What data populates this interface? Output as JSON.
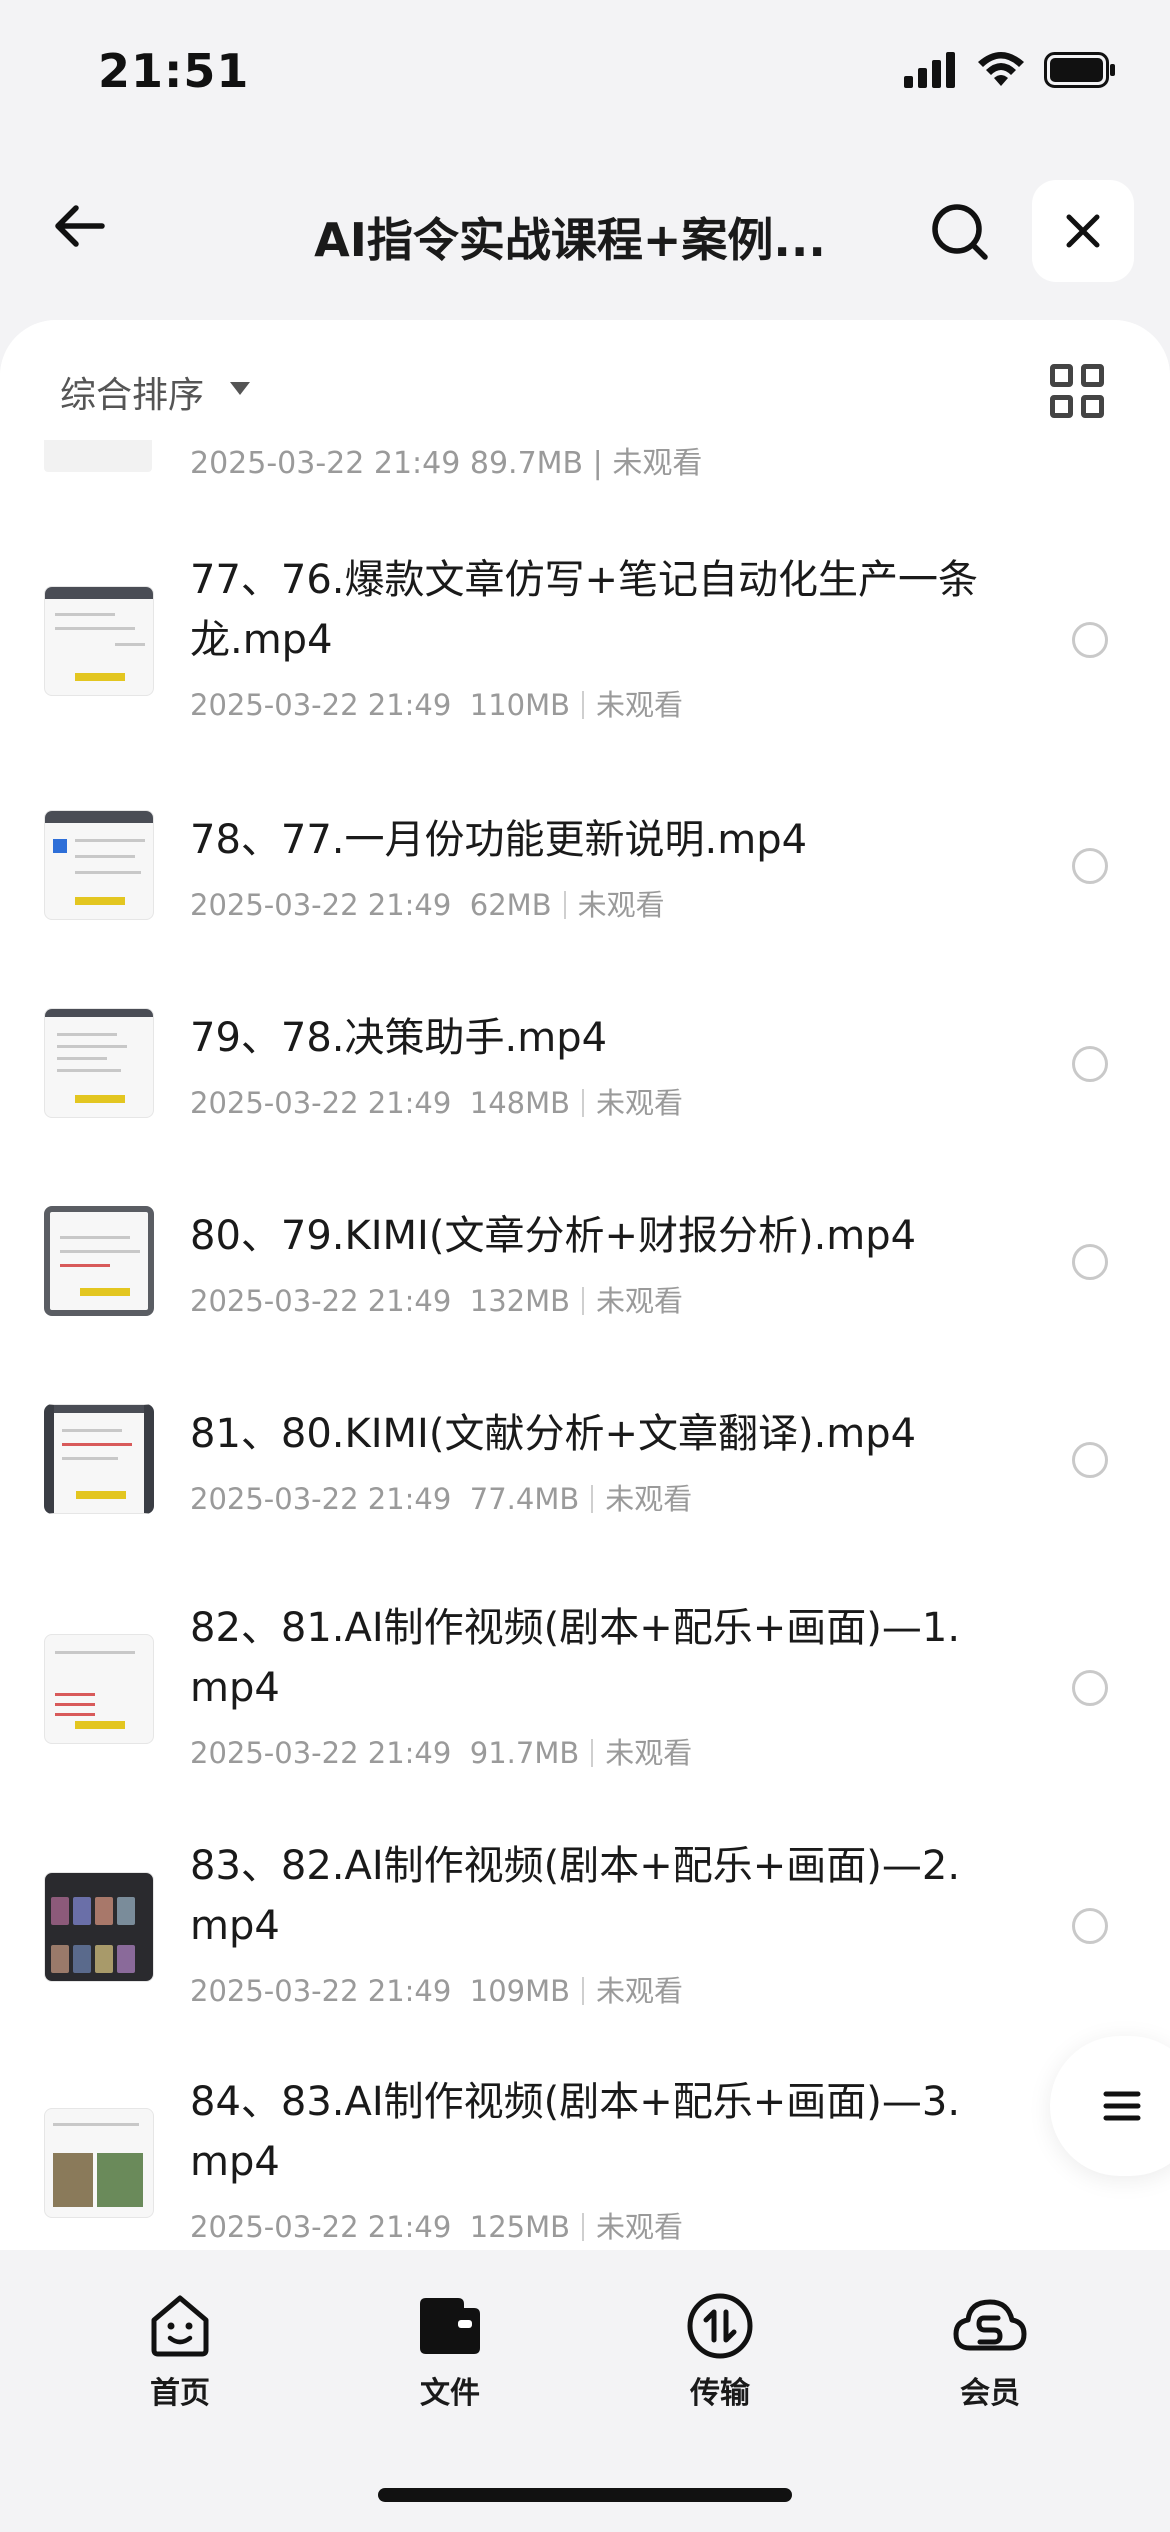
{
  "status_bar": {
    "time": "21:51"
  },
  "header": {
    "title": "AI指令实战课程+案例..."
  },
  "sort": {
    "label": "综合排序"
  },
  "partial_row": {
    "meta": "2025-03-22 21:49  89.7MB | 未观看"
  },
  "files": [
    {
      "name": "77、76.爆款文章仿写+笔记自动化生产一条龙.mp4",
      "date": "2025-03-22 21:49",
      "size": "110MB",
      "status": "未观看"
    },
    {
      "name": "78、77.一月份功能更新说明.mp4",
      "date": "2025-03-22 21:49",
      "size": "62MB",
      "status": "未观看"
    },
    {
      "name": "79、78.决策助手.mp4",
      "date": "2025-03-22 21:49",
      "size": "148MB",
      "status": "未观看"
    },
    {
      "name": "80、79.KIMI(文章分析+财报分析).mp4",
      "date": "2025-03-22 21:49",
      "size": "132MB",
      "status": "未观看"
    },
    {
      "name": "81、80.KIMI(文献分析+文章翻译).mp4",
      "date": "2025-03-22 21:49",
      "size": "77.4MB",
      "status": "未观看"
    },
    {
      "name": "82、81.AI制作视频(剧本+配乐+画面)—1.mp4",
      "date": "2025-03-22 21:49",
      "size": "91.7MB",
      "status": "未观看"
    },
    {
      "name": "83、82.AI制作视频(剧本+配乐+画面)—2.mp4",
      "date": "2025-03-22 21:49",
      "size": "109MB",
      "status": "未观看"
    },
    {
      "name": "84、83.AI制作视频(剧本+配乐+画面)—3.mp4",
      "date": "2025-03-22 21:49",
      "size": "125MB",
      "status": "未观看"
    }
  ],
  "nav": {
    "home": "首页",
    "files": "文件",
    "transfer": "传输",
    "member": "会员"
  },
  "icons": {
    "back": "arrow-left-icon",
    "search": "search-icon",
    "close": "close-icon",
    "grid": "grid-view-icon",
    "menu": "menu-icon"
  }
}
